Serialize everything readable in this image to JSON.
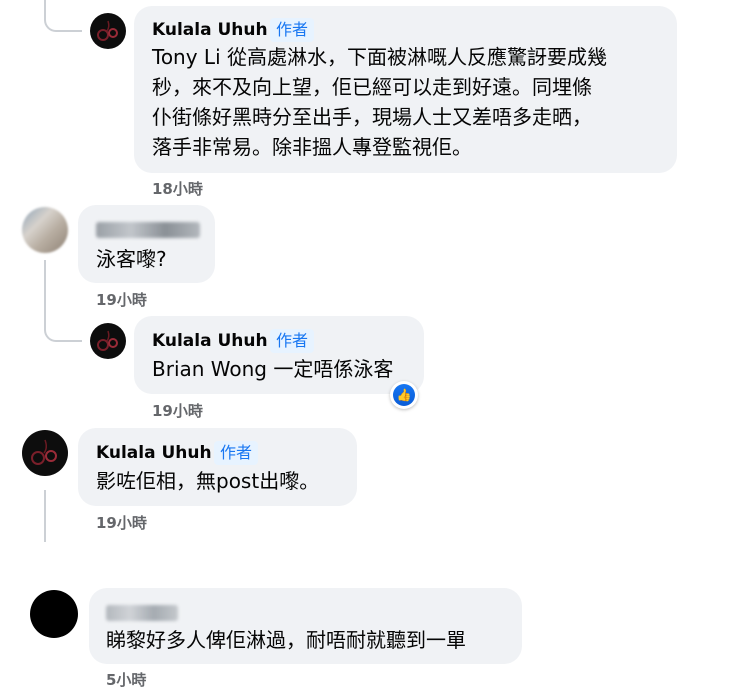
{
  "comments": [
    {
      "name": "Kulala Uhuh",
      "badge": "作者",
      "lines": [
        "Tony Li 從高處淋水，下面被淋嘅人反應驚訝要成幾",
        "秒，來不及向上望，佢已經可以走到好遠。同埋條",
        "仆街條好黑時分至出手，現場人士又差唔多走晒，",
        "落手非常易。除非搵人專登監視佢。"
      ],
      "time": "18小時"
    },
    {
      "text": "泳客嚟?",
      "time": "19小時"
    },
    {
      "name": "Kulala Uhuh",
      "badge": "作者",
      "text": "Brian Wong 一定唔係泳客",
      "time": "19小時",
      "reaction": "like-icon"
    },
    {
      "name": "Kulala Uhuh",
      "badge": "作者",
      "text": "影咗佢相，無post出嚟。",
      "time": "19小時"
    },
    {
      "text": "睇黎好多人俾佢淋過，耐唔耐就聽到一單",
      "time": "5小時"
    }
  ],
  "colors": {
    "bubble": "#f0f2f5",
    "author_badge_bg": "#e7f3ff",
    "author_badge_text": "#1877f2",
    "timestamp": "#65676b"
  }
}
